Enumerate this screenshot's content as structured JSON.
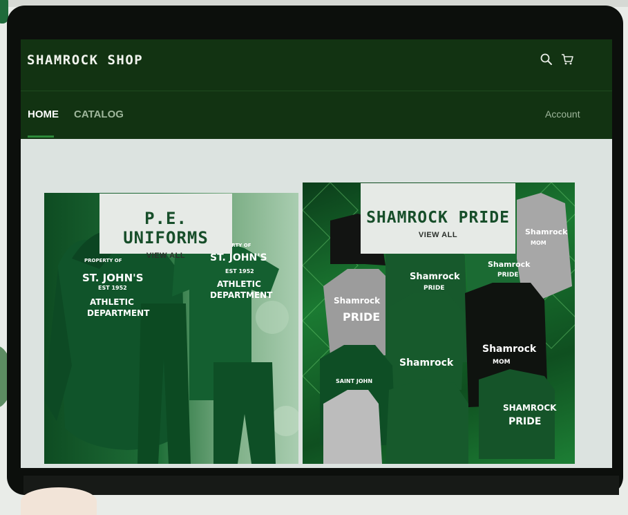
{
  "header": {
    "brand": "SHAMROCK SHOP",
    "icons": [
      "search-icon",
      "cart-icon"
    ]
  },
  "nav": {
    "items": [
      {
        "label": "HOME",
        "active": true
      },
      {
        "label": "CATALOG",
        "active": false
      }
    ],
    "account_label": "Account"
  },
  "collections": [
    {
      "title": "P.E. UNIFORMS",
      "link": "VIEW ALL"
    },
    {
      "title": "SHAMROCK PRIDE",
      "link": "VIEW ALL"
    }
  ],
  "garment_prints": {
    "hoodie": [
      "PROPERTY OF",
      "ST. JOHN'S",
      "EST 1952",
      "ATHLETIC",
      "DEPARTMENT"
    ],
    "tee": [
      "PROPERTY OF",
      "ST. JOHN'S",
      "EST 1952",
      "ATHLETIC",
      "DEPARTMENT"
    ],
    "pride_shirts": [
      "Shamrock",
      "PRIDE",
      "Shamrock",
      "PRIDE",
      "Shamrock",
      "PRIDE",
      "Shamrock",
      "MOM",
      "SAINT JOHN",
      "Shamrock",
      "Shamrock",
      "MOM",
      "SHAMROCK",
      "PRIDE"
    ]
  },
  "colors": {
    "header_bg": "#123312",
    "accent": "#2d8a3a",
    "brand_green": "#174e2a",
    "content_bg": "#dce3e0"
  }
}
